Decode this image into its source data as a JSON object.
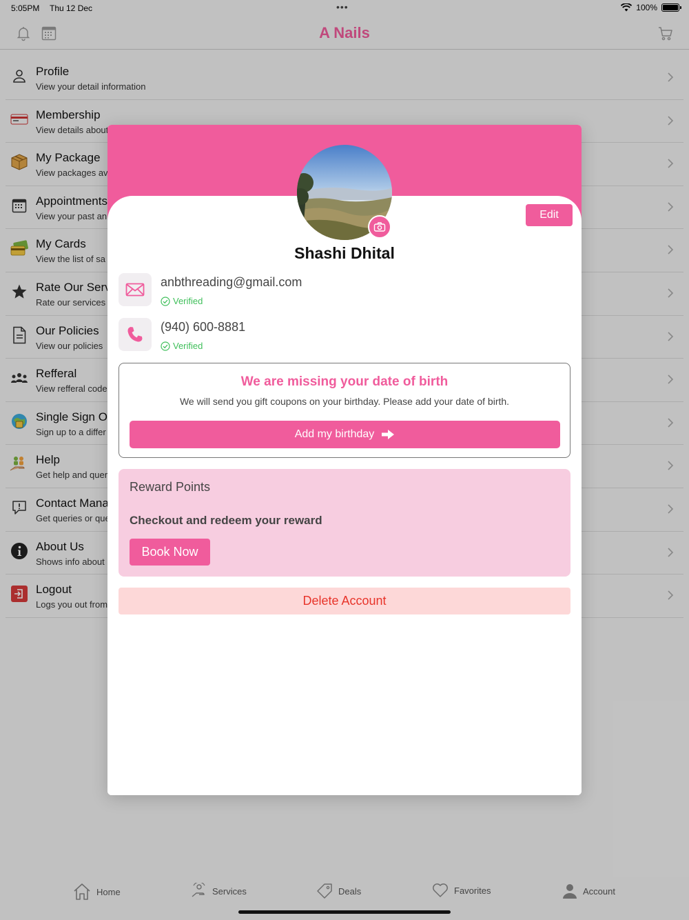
{
  "status_bar": {
    "time": "5:05PM",
    "date": "Thu 12 Dec",
    "battery": "100%"
  },
  "header": {
    "title": "A Nails"
  },
  "menu": [
    {
      "title": "Profile",
      "subtitle": "View your detail information",
      "icon": "person-icon"
    },
    {
      "title": "Membership",
      "subtitle": "View details about",
      "icon": "membership-card-icon"
    },
    {
      "title": "My Package",
      "subtitle": "View packages av",
      "icon": "package-box-icon"
    },
    {
      "title": "Appointments",
      "subtitle": "View your past an",
      "icon": "calendar-icon"
    },
    {
      "title": "My Cards",
      "subtitle": "View the list of sa",
      "icon": "credit-card-icon"
    },
    {
      "title": "Rate Our Serv",
      "subtitle": "Rate our services",
      "icon": "star-icon"
    },
    {
      "title": "Our Policies",
      "subtitle": "View our policies",
      "icon": "document-icon"
    },
    {
      "title": "Refferal",
      "subtitle": "View refferal code",
      "icon": "group-icon"
    },
    {
      "title": "Single Sign Or",
      "subtitle": "Sign up to a differ",
      "icon": "sign-on-icon"
    },
    {
      "title": "Help",
      "subtitle": "Get help and quer",
      "icon": "help-hand-icon"
    },
    {
      "title": "Contact Mana",
      "subtitle": "Get queries or que",
      "icon": "chat-alert-icon"
    },
    {
      "title": "About Us",
      "subtitle": "Shows info about",
      "icon": "info-icon"
    },
    {
      "title": "Logout",
      "subtitle": "Logs you out from",
      "icon": "logout-icon"
    }
  ],
  "tabs": [
    {
      "label": "Home",
      "icon": "home-icon"
    },
    {
      "label": "Services",
      "icon": "services-icon"
    },
    {
      "label": "Deals",
      "icon": "tag-icon"
    },
    {
      "label": "Favorites",
      "icon": "heart-icon"
    },
    {
      "label": "Account",
      "icon": "account-icon"
    }
  ],
  "profile_modal": {
    "name": "Shashi Dhital",
    "edit_label": "Edit",
    "email": "anbthreading@gmail.com",
    "email_status": "Verified",
    "phone": "(940) 600-8881",
    "phone_status": "Verified",
    "dob_title": "We are missing your date of birth",
    "dob_text": "We will send you gift coupons on your birthday. Please add your date of birth.",
    "dob_button": "Add my birthday",
    "reward_title": "Reward Points",
    "reward_text": "Checkout and redeem your reward",
    "book_button": "Book Now",
    "delete_button": "Delete Account"
  },
  "colors": {
    "accent": "#f05c9c",
    "verified": "#3fbf5a",
    "danger": "#e8342a",
    "reward_bg": "#f7cde0",
    "delete_bg": "#fdd8d8"
  }
}
